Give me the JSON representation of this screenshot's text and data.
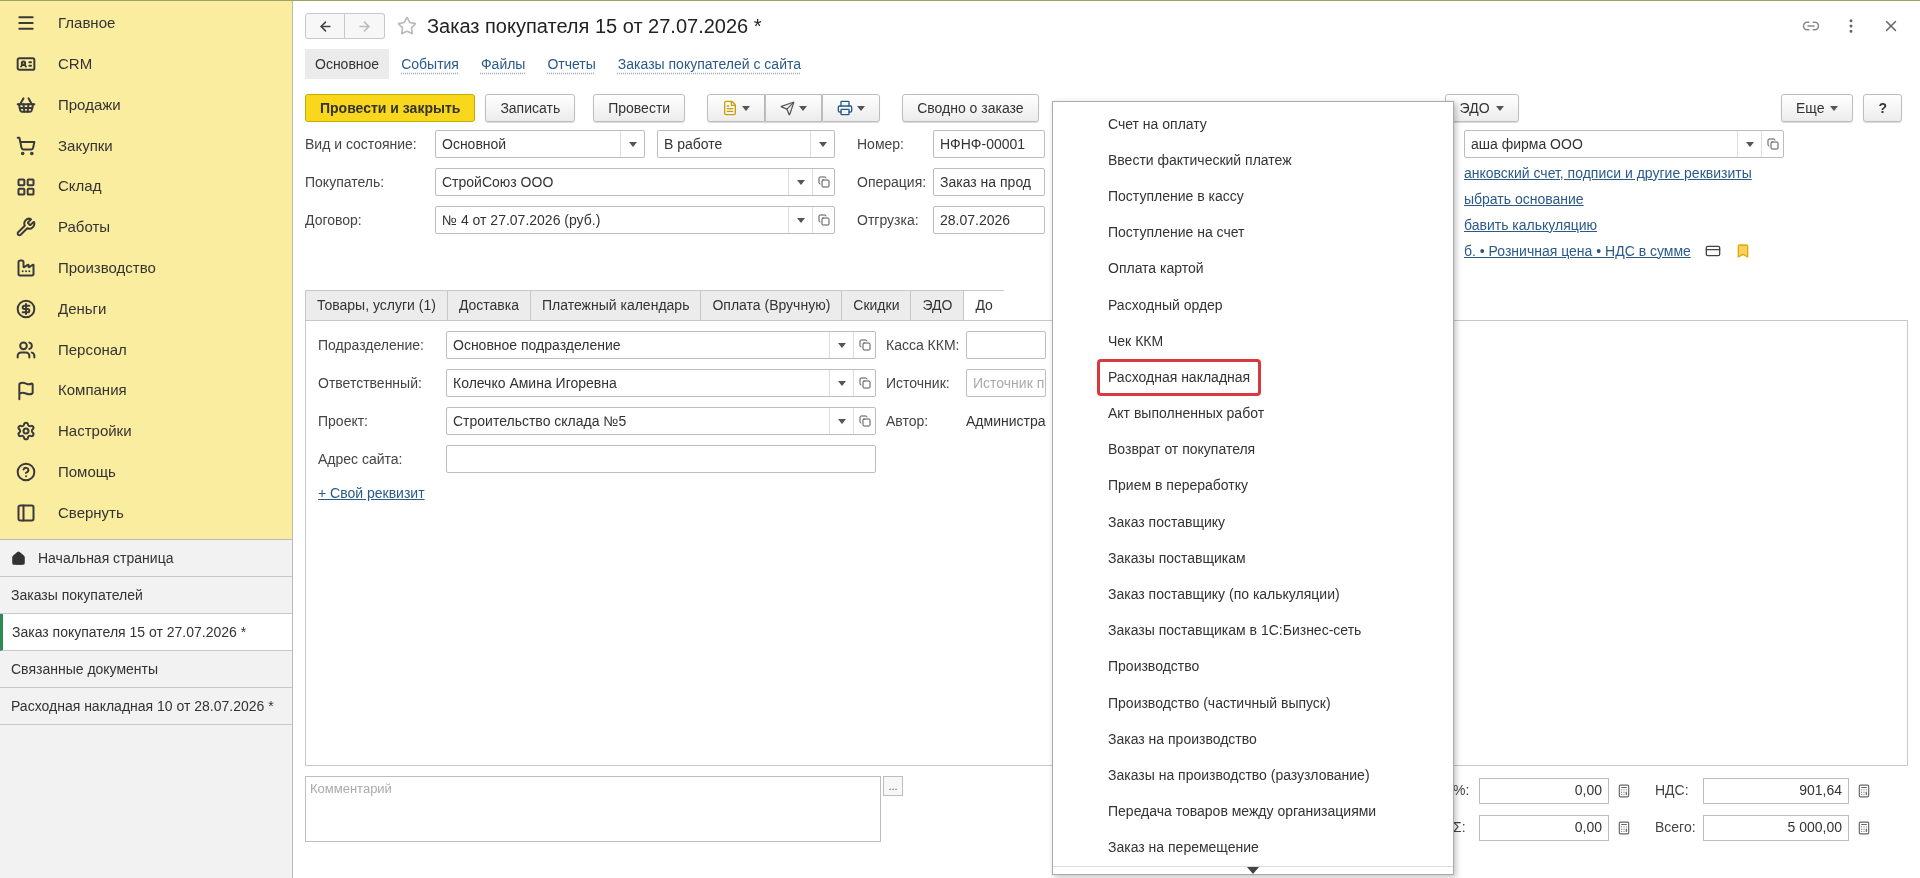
{
  "sidebar": {
    "sections": [
      {
        "label": "Главное"
      },
      {
        "label": "CRM"
      },
      {
        "label": "Продажи"
      },
      {
        "label": "Закупки"
      },
      {
        "label": "Склад"
      },
      {
        "label": "Работы"
      },
      {
        "label": "Производство"
      },
      {
        "label": "Деньги"
      },
      {
        "label": "Персонал"
      },
      {
        "label": "Компания"
      },
      {
        "label": "Настройки"
      },
      {
        "label": "Помощь"
      },
      {
        "label": "Свернуть"
      }
    ],
    "open_windows": [
      {
        "label": "Начальная страница",
        "kind": "home",
        "selected": false
      },
      {
        "label": "Заказы покупателей",
        "kind": "page",
        "selected": false
      },
      {
        "label": "Заказ покупателя 15 от 27.07.2026 *",
        "kind": "page",
        "selected": true
      },
      {
        "label": "Связанные документы",
        "kind": "page",
        "selected": false
      },
      {
        "label": "Расходная накладная 10 от 28.07.2026 *",
        "kind": "page",
        "selected": false
      }
    ]
  },
  "form": {
    "title": "Заказ покупателя 15 от 27.07.2026 *",
    "nav_tabs": [
      {
        "label": "Основное",
        "selected": true
      },
      {
        "label": "События",
        "selected": false
      },
      {
        "label": "Файлы",
        "selected": false
      },
      {
        "label": "Отчеты",
        "selected": false
      },
      {
        "label": "Заказы покупателей с сайта",
        "selected": false
      }
    ],
    "toolbar": {
      "post_close": "Провести и закрыть",
      "save": "Записать",
      "post": "Провести",
      "summary": "Сводно о заказе",
      "edo": "ЭДО",
      "more": "Еще",
      "help": "?"
    },
    "fields": {
      "kind_label": "Вид и состояние:",
      "kind_value": "Основной",
      "state_value": "В работе",
      "customer_label": "Покупатель:",
      "customer_value": "СтройСоюз ООО",
      "contract_label": "Договор:",
      "contract_value": "№ 4 от 27.07.2026 (руб.)",
      "number_label": "Номер:",
      "number_value": "НФНФ-00001",
      "operation_label": "Операция:",
      "operation_value": "Заказ на прод",
      "shipment_label": "Отгрузка:",
      "shipment_value": "28.07.2026",
      "company_value": "аша фирма ООО"
    },
    "right_links": [
      "анковский счет, подписи и другие реквизиты",
      "ыбрать основание",
      "бавить калькуляцию",
      "б. • Розничная цена • НДС в сумме"
    ],
    "tabs": [
      {
        "label": "Товары, услуги (1)",
        "selected": false
      },
      {
        "label": "Доставка",
        "selected": false
      },
      {
        "label": "Платежный календарь",
        "selected": false
      },
      {
        "label": "Оплата (Вручную)",
        "selected": false
      },
      {
        "label": "Скидки",
        "selected": false
      },
      {
        "label": "ЭДО",
        "selected": false
      },
      {
        "label": "До",
        "selected": true
      }
    ],
    "tab_fields": {
      "department_label": "Подразделение:",
      "department_value": "Основное подразделение",
      "responsible_label": "Ответственный:",
      "responsible_value": "Колечко Амина Игоревна",
      "project_label": "Проект:",
      "project_value": "Строительство склада №5",
      "site_label": "Адрес сайта:",
      "custom_link": "+ Свой реквизит",
      "cash_label": "Касса ККМ:",
      "source_label": "Источник:",
      "source_placeholder": "Источник п",
      "author_label": "Автор:",
      "author_value": "Администра"
    },
    "comment": {
      "placeholder": "Комментарий",
      "button": "..."
    },
    "totals": [
      {
        "label": "%:",
        "value": "0,00"
      },
      {
        "label": "НДС:",
        "value": "901,64"
      },
      {
        "label": "Σ:",
        "value": "0,00"
      },
      {
        "label": "Всего:",
        "value": "5 000,00"
      }
    ]
  },
  "create_menu": {
    "items": [
      {
        "label": "Счет на оплату",
        "highlighted": false
      },
      {
        "label": "Ввести фактический платеж",
        "highlighted": false
      },
      {
        "label": "Поступление в кассу",
        "highlighted": false
      },
      {
        "label": "Поступление на счет",
        "highlighted": false
      },
      {
        "label": "Оплата картой",
        "highlighted": false
      },
      {
        "label": "Расходный ордер",
        "highlighted": false
      },
      {
        "label": "Чек ККМ",
        "highlighted": false
      },
      {
        "label": "Расходная накладная",
        "highlighted": true
      },
      {
        "label": "Акт выполненных работ",
        "highlighted": false
      },
      {
        "label": "Возврат от покупателя",
        "highlighted": false
      },
      {
        "label": "Прием в переработку",
        "highlighted": false
      },
      {
        "label": "Заказ поставщику",
        "highlighted": false
      },
      {
        "label": "Заказы поставщикам",
        "highlighted": false
      },
      {
        "label": "Заказ поставщику (по калькуляции)",
        "highlighted": false
      },
      {
        "label": "Заказы поставщикам в 1С:Бизнес-сеть",
        "highlighted": false
      },
      {
        "label": "Производство",
        "highlighted": false
      },
      {
        "label": "Производство (частичный выпуск)",
        "highlighted": false
      },
      {
        "label": "Заказ на производство",
        "highlighted": false
      },
      {
        "label": "Заказы на производство (разузлование)",
        "highlighted": false
      },
      {
        "label": "Передача товаров между организациями",
        "highlighted": false
      },
      {
        "label": "Заказ на перемещение",
        "highlighted": false
      }
    ]
  }
}
